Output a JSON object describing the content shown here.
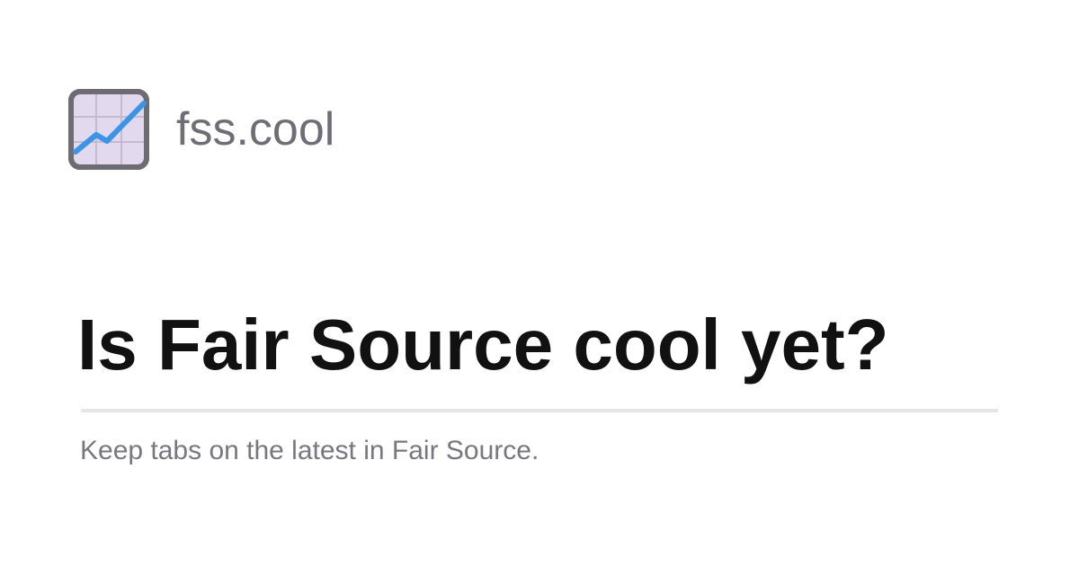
{
  "brand": {
    "logo_icon": "chart-increasing-icon",
    "site_name": "fss.cool"
  },
  "hero": {
    "title": "Is Fair Source cool yet?",
    "subtitle": "Keep tabs on the latest in Fair Source."
  },
  "colors": {
    "background": "#ffffff",
    "title_text": "#111111",
    "muted_text": "#6f6e77",
    "divider": "#e6e6e8",
    "logo_frame": "#6d6c73",
    "logo_fill": "#e2d9ee",
    "logo_line": "#3a95e8"
  }
}
